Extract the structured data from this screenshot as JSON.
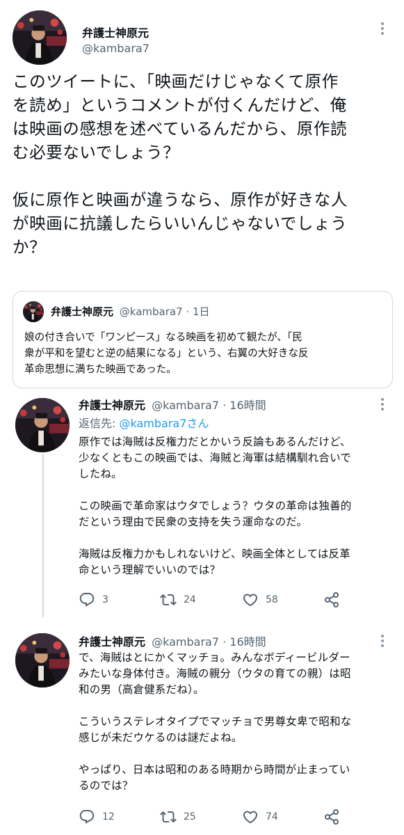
{
  "main_tweet": {
    "display_name": "弁護士神原元",
    "handle": "@kambara7",
    "text": "このツイートに、「映画だけじゃなくて原作\nを読め」というコメントが付くんだけど、俺\nは映画の感想を述べているんだから、原作読\nむ必要ないでしょう？\n\n仮に原作と映画が違うなら、原作が好きな人\nが映画に抗議したらいいんじゃないでしょう\nか？"
  },
  "quoted_tweet": {
    "display_name": "弁護士神原元",
    "handle_time": "@kambara7 · 1日",
    "text": "娘の付き合いで「ワンピース」なる映画を初めて観たが、「民\n衆が平和を望むと逆の結果になる」という、右翼の大好きな反\n革命思想に満ちた映画であった。"
  },
  "replies": [
    {
      "display_name": "弁護士神原元",
      "handle_time": "@kambara7 · 16時間",
      "reply_to_prefix": "返信先: ",
      "reply_to_handle": "@kambara7さん",
      "text": "原作では海賊は反権力だとかいう反論もあるんだけど、\n少なくともこの映画では、海賊と海軍は結構馴れ合いで\nしたね。\n\nこの映画で革命家はウタでしょう？ウタの革命は独善的\nだという理由で民衆の支持を失う運命なのだ。\n\n海賊は反権力かもしれないけど、映画全体としては反革\n命という理解でいいのでは？",
      "replies": "3",
      "retweets": "24",
      "likes": "58"
    },
    {
      "display_name": "弁護士神原元",
      "handle_time": "@kambara7 · 16時間",
      "text": "で、海賊はとにかくマッチョ。みんなボディービルダー\nみたいな身体付き。海賊の親分（ウタの育ての親）は昭\n和の男（高倉健系だね）。\n\nこういうステレオタイプでマッチョで男尊女卑で昭和な\n感じが未だウケるのは謎だよね。\n\nやっぱり、日本は昭和のある時期から時間が止まってい\nるのでは？",
      "replies": "12",
      "retweets": "25",
      "likes": "74"
    }
  ],
  "icons": [
    "avatar-photo",
    "more-icon",
    "reply-icon",
    "retweet-icon",
    "like-icon",
    "share-icon"
  ],
  "colors": {
    "link": "#1d9bf0",
    "muted": "#536471",
    "border": "#cfd9de"
  }
}
